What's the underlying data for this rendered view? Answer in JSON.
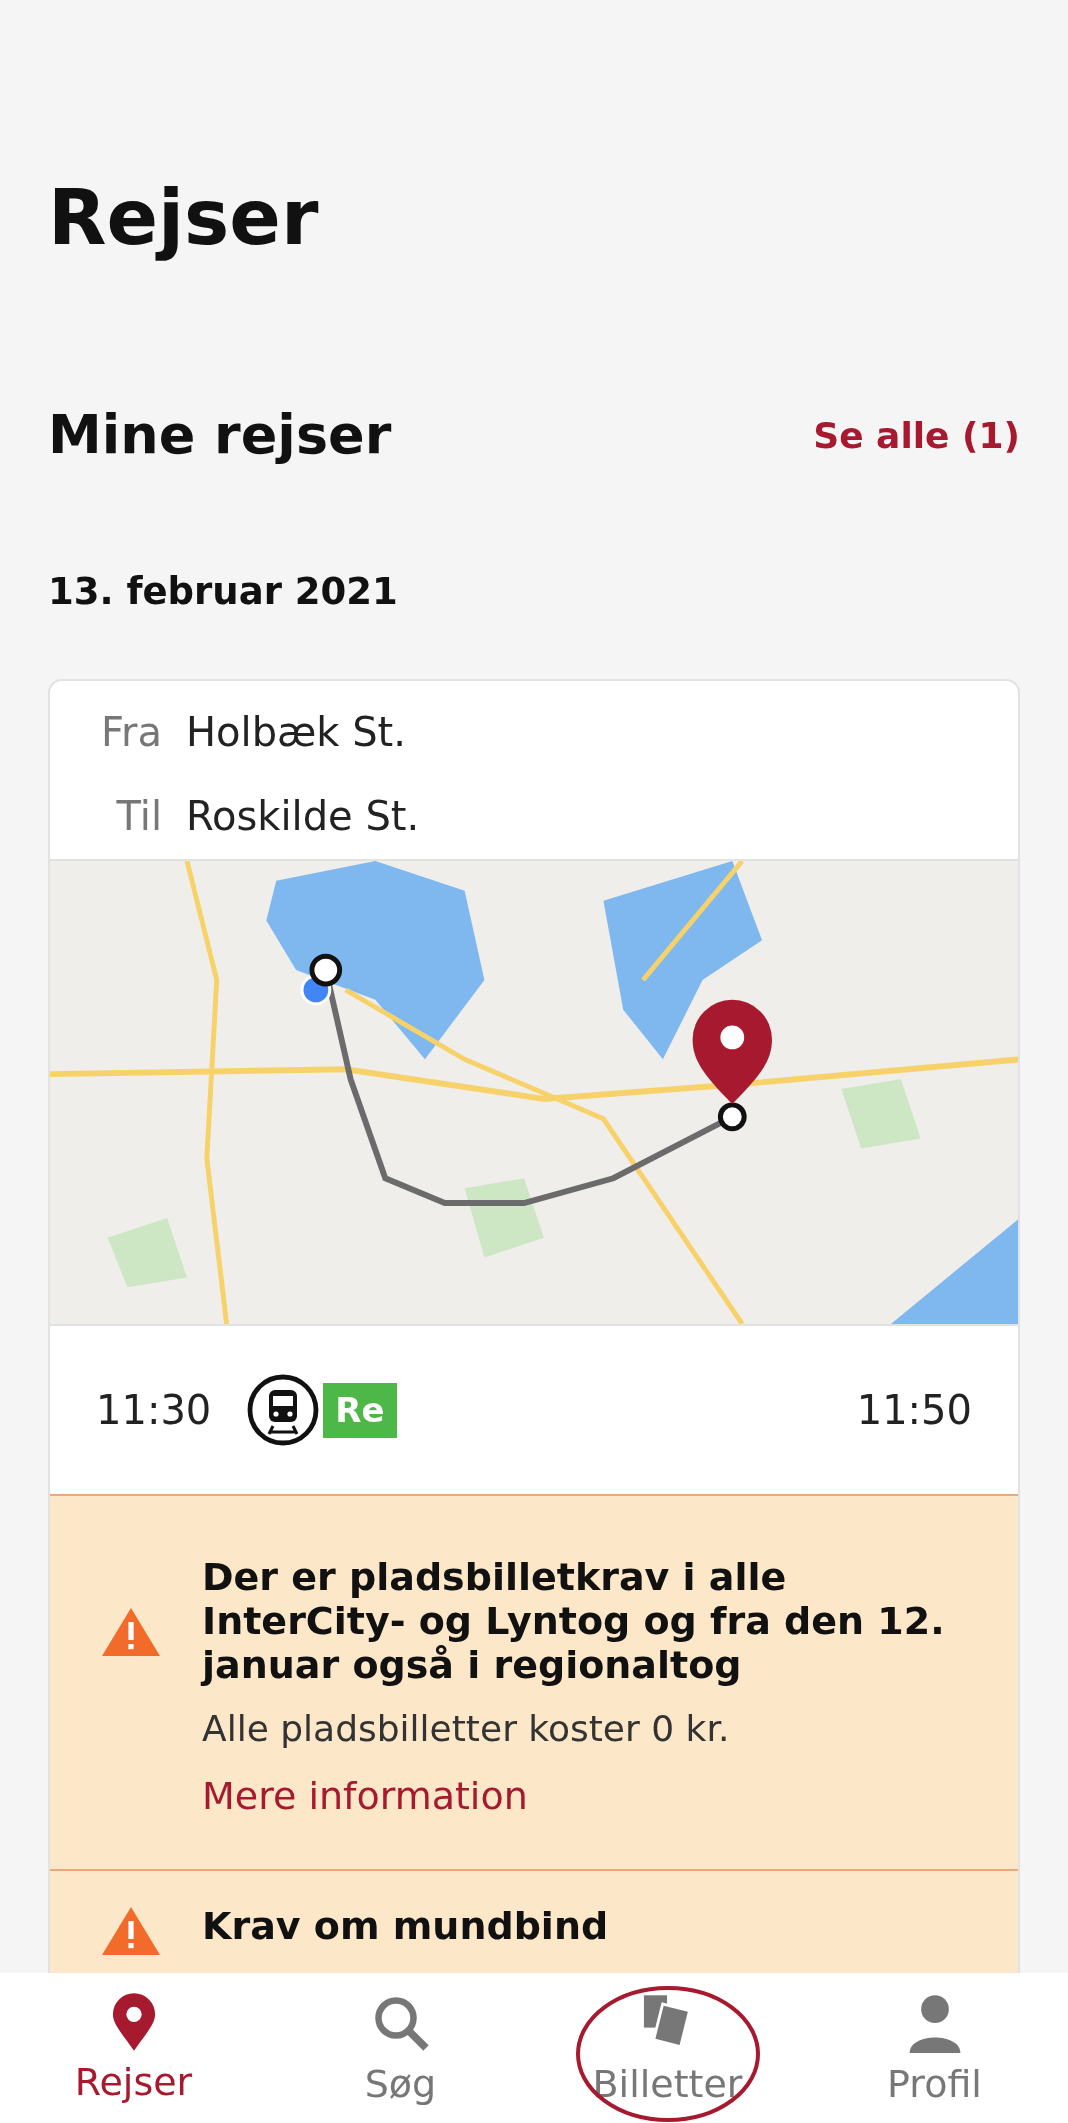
{
  "page_title": "Rejser",
  "section": {
    "title": "Mine rejser",
    "link": "Se alle (1)"
  },
  "date": "13. februar 2021",
  "journey": {
    "from_label": "Fra",
    "from": "Holbæk St.",
    "to_label": "Til",
    "to": "Roskilde St.",
    "departure": "11:30",
    "train_type": "Re",
    "arrival": "11:50"
  },
  "notices": [
    {
      "title": "Der er pladsbilletkrav i alle InterCity- og Lyntog og fra den 12. januar også i regionaltog",
      "body": "Alle pladsbilletter koster 0 kr.",
      "link": "Mere information"
    },
    {
      "title": "Krav om mundbind"
    }
  ],
  "tabs": [
    {
      "label": "Rejser",
      "selected": true,
      "kind": "pin",
      "circled": false
    },
    {
      "label": "Søg",
      "selected": false,
      "kind": "search",
      "circled": false
    },
    {
      "label": "Billetter",
      "selected": false,
      "kind": "tickets",
      "circled": true
    },
    {
      "label": "Profil",
      "selected": false,
      "kind": "person",
      "circled": false
    }
  ]
}
